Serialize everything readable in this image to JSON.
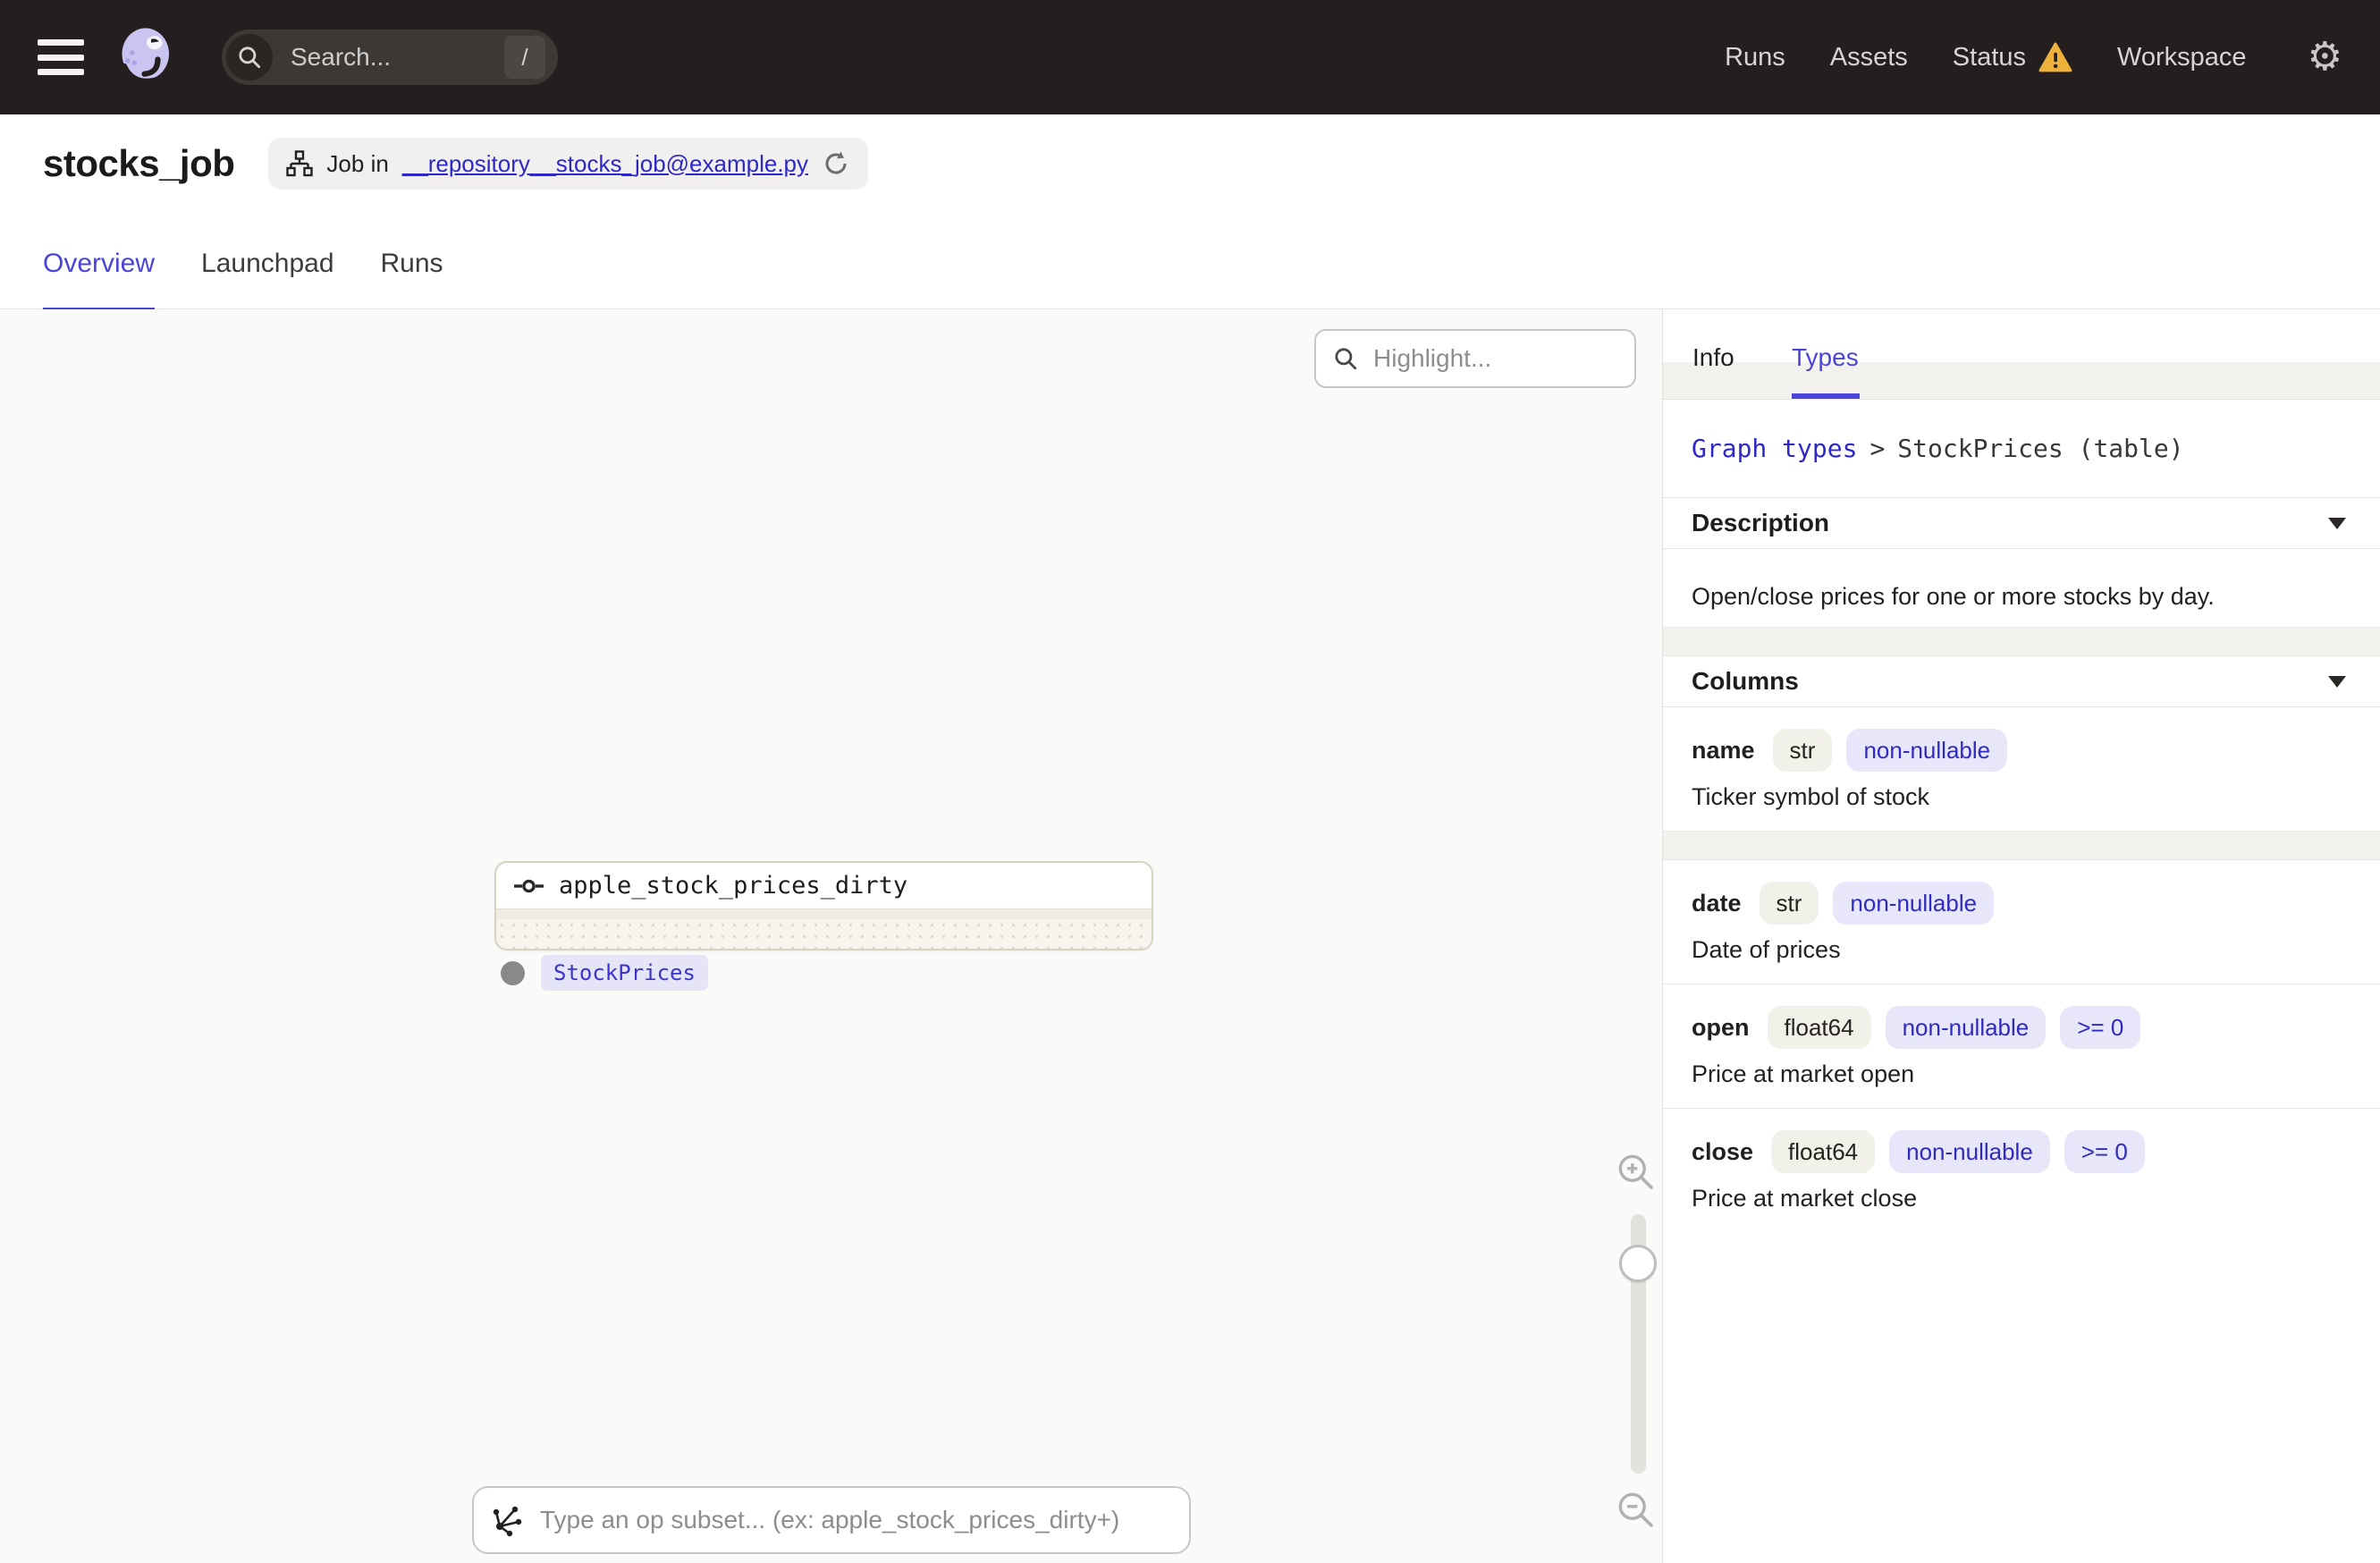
{
  "theme": {
    "accent": "#4a44d9",
    "link": "#2e28c8",
    "warning": "#f0b03c",
    "topbar": "#241f1e",
    "tag-bg": "#e8e7f9",
    "tag-text": "#2f2ac0",
    "type-tag-bg": "#f1f0e9"
  },
  "topbar": {
    "search": {
      "placeholder": "Search...",
      "shortcut": "/"
    },
    "nav": [
      {
        "label": "Runs"
      },
      {
        "label": "Assets"
      },
      {
        "label": "Status"
      },
      {
        "label": "Workspace"
      }
    ]
  },
  "page": {
    "title": "stocks_job",
    "job_badge": {
      "prefix": "Job in",
      "file": "__repository__stocks_job@example.py"
    },
    "tabs": [
      {
        "label": "Overview"
      },
      {
        "label": "Launchpad"
      },
      {
        "label": "Runs"
      }
    ]
  },
  "canvas": {
    "highlight_placeholder": "Highlight...",
    "node": {
      "name": "apple_stock_prices_dirty",
      "output_type": "StockPrices"
    },
    "op_subset_placeholder": "Type an op subset... (ex: apple_stock_prices_dirty+)"
  },
  "sidebar": {
    "tabs": [
      {
        "label": "Info"
      },
      {
        "label": "Types"
      }
    ],
    "breadcrumb": {
      "link": "Graph types",
      "separator": ">",
      "current": "StockPrices (table)"
    },
    "description": {
      "heading": "Description",
      "text": "Open/close prices for one or more stocks by day."
    },
    "columns": {
      "heading": "Columns",
      "items": [
        {
          "name": "name",
          "type": "str",
          "tags": [
            "non-nullable"
          ],
          "description": "Ticker symbol of stock"
        },
        {
          "name": "date",
          "type": "str",
          "tags": [
            "non-nullable"
          ],
          "description": "Date of prices"
        },
        {
          "name": "open",
          "type": "float64",
          "tags": [
            "non-nullable",
            ">= 0"
          ],
          "description": "Price at market open"
        },
        {
          "name": "close",
          "type": "float64",
          "tags": [
            "non-nullable",
            ">= 0"
          ],
          "description": "Price at market close"
        }
      ]
    }
  }
}
